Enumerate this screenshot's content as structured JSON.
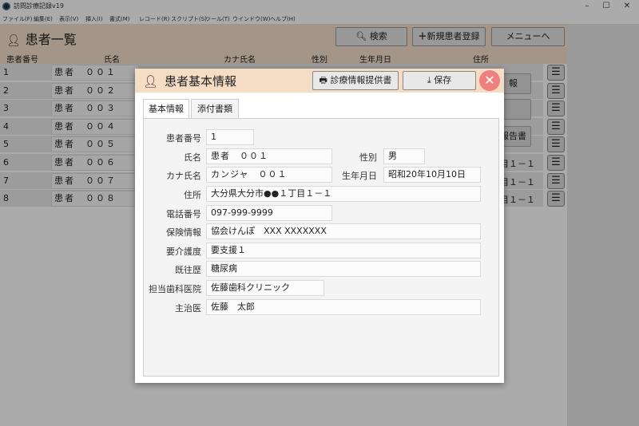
{
  "window": {
    "title": "訪問診療記録v19",
    "minimize": "–",
    "maximize": "☐",
    "close": "✕"
  },
  "menu": [
    "ファイル(F)",
    "編集(E)",
    "表示(V)",
    "挿入(I)",
    "書式(M)",
    "レコード(R)",
    "スクリプト(S)",
    "ツール(T)",
    "ウインドウ(W)",
    "ヘルプ(H)"
  ],
  "list_header": {
    "title": "患者一覧",
    "search_label": "検索",
    "new_patient_label": "新規患者登録",
    "menu_label": "メニューへ"
  },
  "columns": {
    "id": "患者番号",
    "name": "氏名",
    "kana": "カナ氏名",
    "sex": "性別",
    "dob": "生年月日",
    "address": "住所"
  },
  "patients": [
    {
      "num": "1",
      "name": "患者　００１",
      "addr": ""
    },
    {
      "num": "2",
      "name": "患者　００２",
      "addr": ""
    },
    {
      "num": "3",
      "name": "患者　００３",
      "addr": ""
    },
    {
      "num": "4",
      "name": "患者　００４",
      "addr": ""
    },
    {
      "num": "5",
      "name": "患者　００５",
      "addr": ""
    },
    {
      "num": "6",
      "name": "患者　００６",
      "addr": "目１－１"
    },
    {
      "num": "7",
      "name": "患者　００７",
      "addr": "目１－１"
    },
    {
      "num": "8",
      "name": "患者　００８",
      "addr": "目１－１"
    }
  ],
  "partial_buttons": [
    "報",
    "",
    "報告書"
  ],
  "dialog": {
    "title": "患者基本情報",
    "provide_info_label": "診療情報提供書",
    "save_label": "保存",
    "close_glyph": "✕",
    "tabs": [
      "基本情報",
      "添付書類"
    ],
    "fields": {
      "patient_number": {
        "label": "患者番号",
        "value": "1"
      },
      "name": {
        "label": "氏名",
        "value": "患者　００１"
      },
      "sex": {
        "label": "性別",
        "value": "男"
      },
      "kana": {
        "label": "カナ氏名",
        "value": "カンジャ　００１"
      },
      "dob": {
        "label": "生年月日",
        "value": "昭和20年10月10日"
      },
      "address": {
        "label": "住所",
        "value": "大分県大分市●●１丁目１－１"
      },
      "phone": {
        "label": "電話番号",
        "value": "097-999-9999"
      },
      "insurance": {
        "label": "保険情報",
        "value": "協会けんぽ　XXX XXXXXXX"
      },
      "care_level": {
        "label": "要介護度",
        "value": "要支援１"
      },
      "history": {
        "label": "既往歴",
        "value": "糖尿病"
      },
      "dentist": {
        "label": "担当歯科医院",
        "value": "佐藤歯科クリニック"
      },
      "doctor": {
        "label": "主治医",
        "value": "佐藤　太郎"
      }
    }
  },
  "colors": {
    "header_bg": "#f3dfc9",
    "dialog_header_bg": "#f5dcc4",
    "close_bg": "#f08080"
  }
}
